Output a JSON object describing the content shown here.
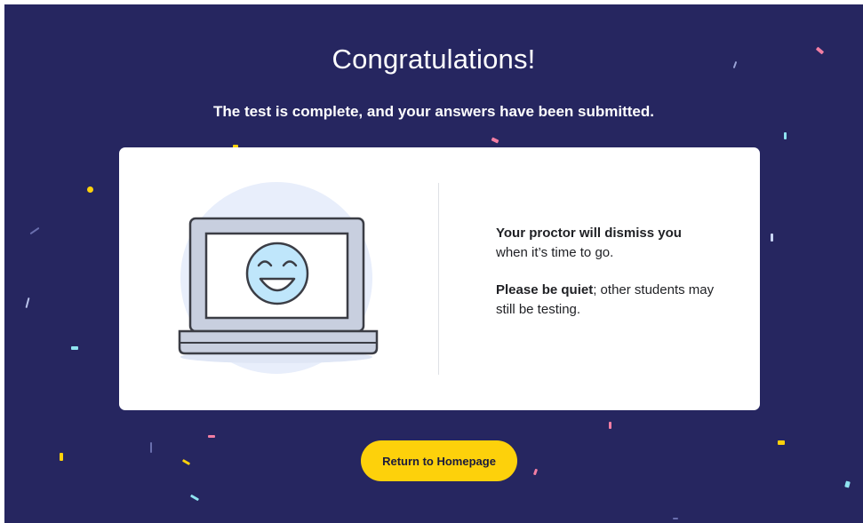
{
  "page": {
    "title": "Congratulations!",
    "subtitle": "The test is complete, and your answers have been submitted."
  },
  "card": {
    "message1_bold": "Your proctor will dismiss you",
    "message1_rest": "when it’s time to go.",
    "message2_bold": "Please be quiet",
    "message2_rest": "; other students may still be testing."
  },
  "actions": {
    "return_label": "Return to Homepage"
  },
  "colors": {
    "background": "#262660",
    "button": "#fdd10b",
    "card": "#ffffff"
  },
  "icons": {
    "illustration": "laptop-smiley-illustration"
  }
}
